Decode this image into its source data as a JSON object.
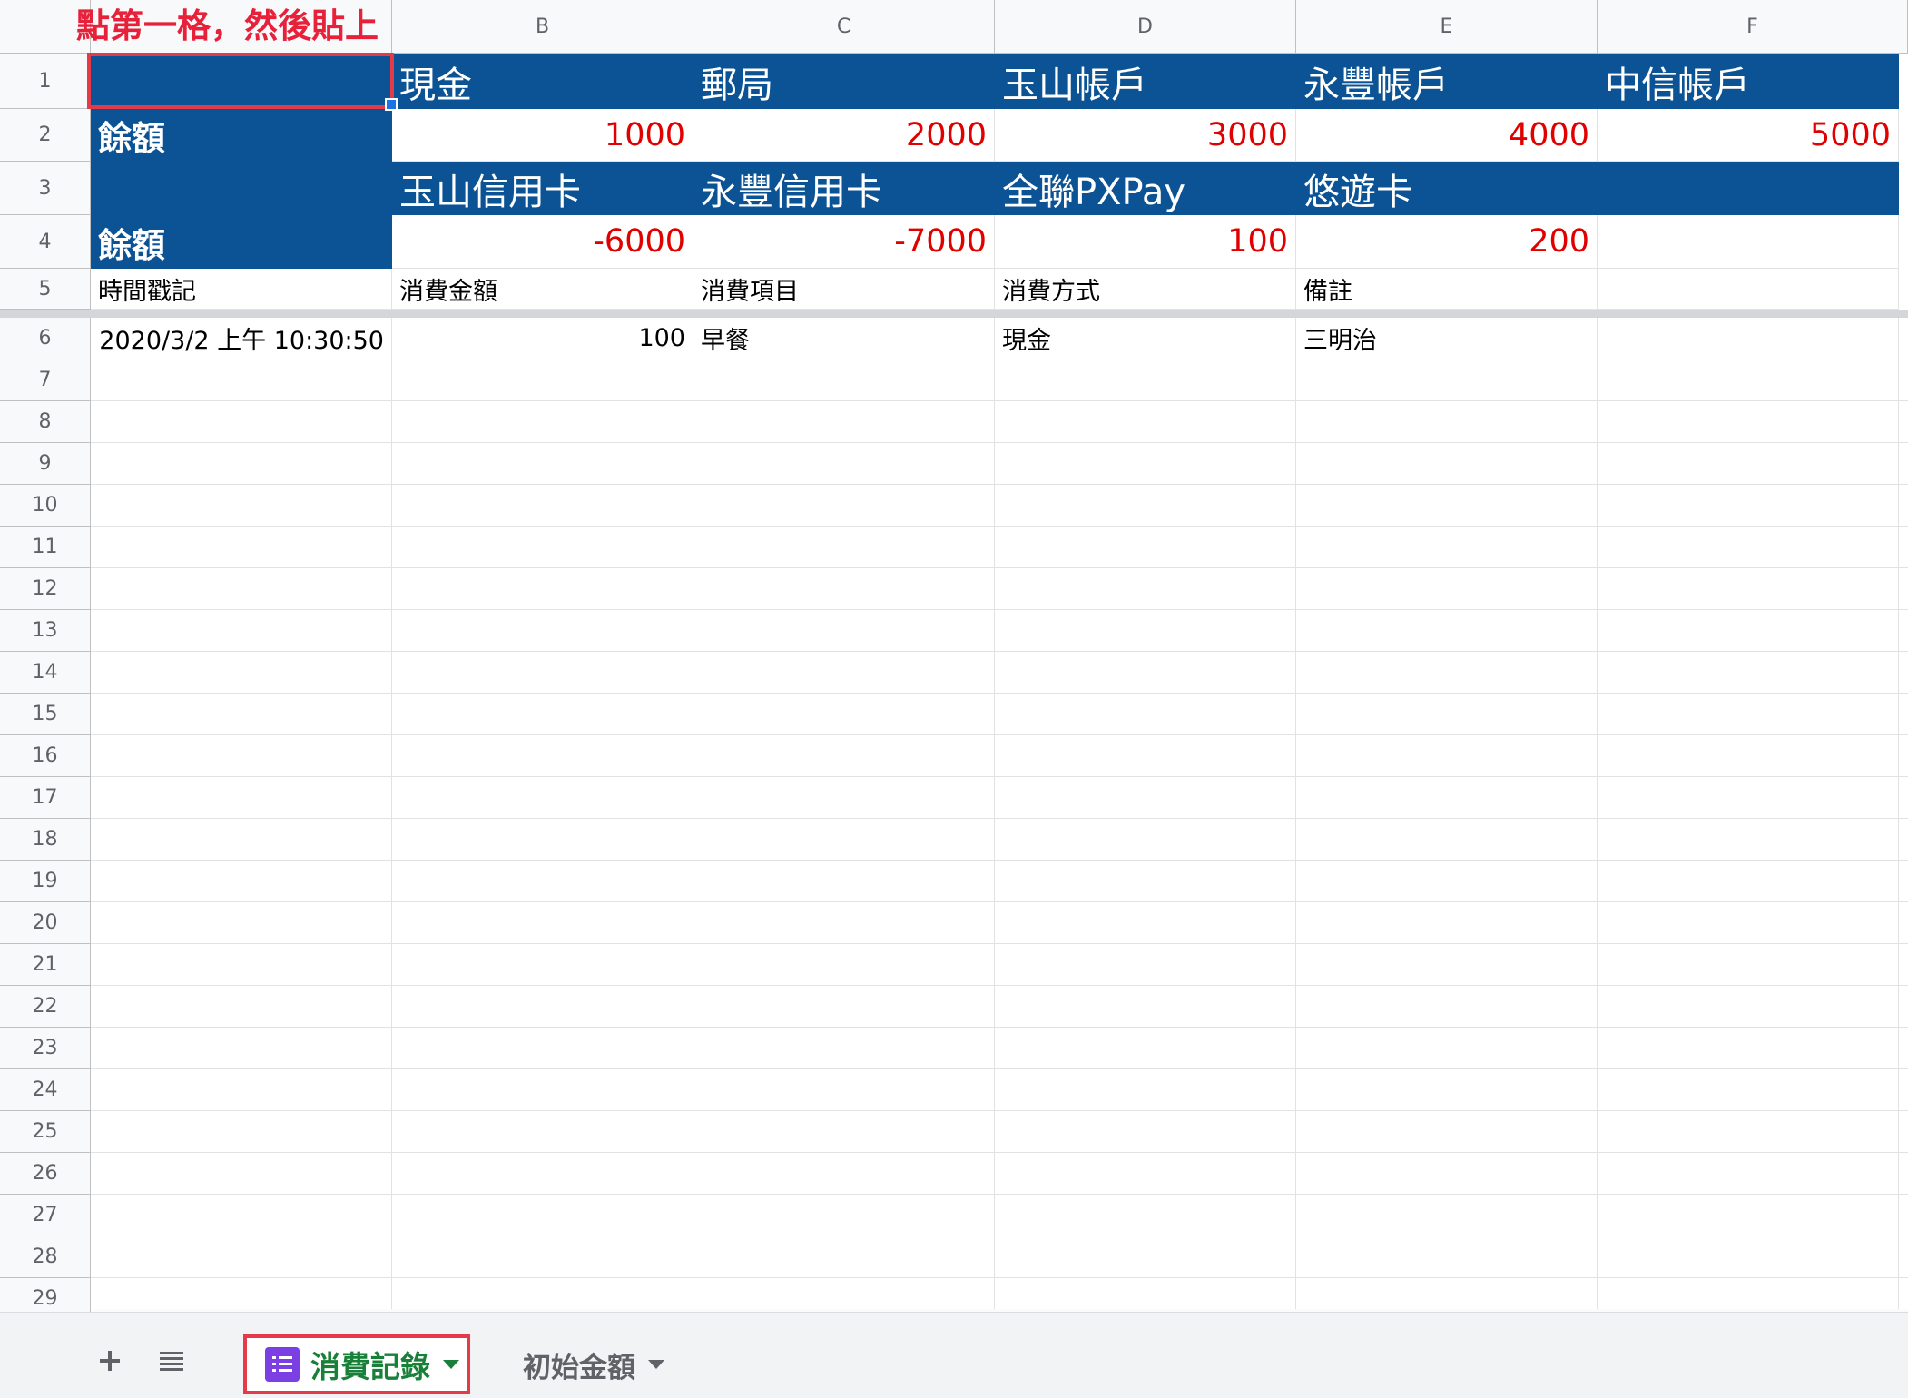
{
  "annotation": "點第一格，然後貼上",
  "columns": [
    "B",
    "C",
    "D",
    "E",
    "F"
  ],
  "rows": [
    "1",
    "2",
    "3",
    "4",
    "5",
    "6",
    "7",
    "8",
    "9",
    "10",
    "11",
    "12",
    "13",
    "14",
    "15",
    "16",
    "17",
    "18",
    "19",
    "20",
    "21",
    "22",
    "23",
    "24",
    "25",
    "26",
    "27",
    "28",
    "29"
  ],
  "accounts_row1": [
    "現金",
    "郵局",
    "玉山帳戶",
    "永豐帳戶",
    "中信帳戶"
  ],
  "balance_label": "餘額",
  "balances_row2": [
    "1000",
    "2000",
    "3000",
    "4000",
    "5000"
  ],
  "accounts_row3": [
    "玉山信用卡",
    "永豐信用卡",
    "全聯PXPay",
    "悠遊卡"
  ],
  "balances_row4": [
    "-6000",
    "-7000",
    "100",
    "200"
  ],
  "headers_row5": [
    "時間戳記",
    "消費金額",
    "消費項目",
    "消費方式",
    "備註"
  ],
  "record_row6": {
    "timestamp": "2020/3/2 上午 10:30:50",
    "amount": "100",
    "item": "早餐",
    "method": "現金",
    "note": "三明治"
  },
  "sheet_tabs": {
    "active": "消費記錄",
    "inactive": "初始金額"
  },
  "colors": {
    "header_fill": "#0b5394",
    "highlight": "#e53a4a",
    "negative_red": "#e00000",
    "active_tab": "#188038"
  },
  "icons": [
    "add-sheet-icon",
    "all-sheets-icon",
    "form-icon",
    "chevron-down-icon"
  ]
}
